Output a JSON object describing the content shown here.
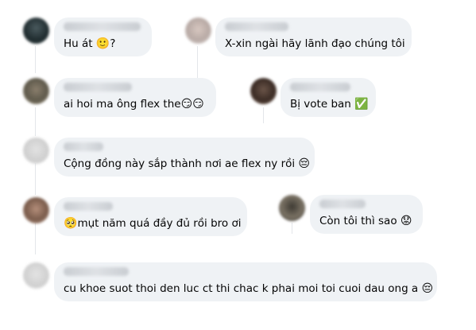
{
  "comments": [
    {
      "text": "Hu át ",
      "emoji": "🙂",
      "suffix": "?"
    },
    {
      "text": "X-xin ngài hãy lãnh đạo chúng tôi",
      "emoji": "",
      "suffix": ""
    },
    {
      "text": "ai hoi ma ông flex the",
      "emoji": "😏😏",
      "suffix": ""
    },
    {
      "text": "Bị vote ban ",
      "emoji": "✅",
      "suffix": ""
    },
    {
      "text": "Cộng đồng này sắp thành nơi ae flex ny rồi ",
      "emoji": "😔",
      "suffix": ""
    },
    {
      "text": "mụt năm quá đầy đủ rồi bro ơi",
      "prefix_emoji": "🥺",
      "emoji": "",
      "suffix": ""
    },
    {
      "text": "Còn tôi thì sao ",
      "emoji": "😟",
      "suffix": ""
    },
    {
      "text": "cu khoe suot thoi den luc ct thi chac k phai moi toi cuoi dau ong a ",
      "emoji": "😔",
      "suffix": ""
    }
  ],
  "colors": {
    "bubble": "#eff2f5",
    "text": "#050505"
  }
}
